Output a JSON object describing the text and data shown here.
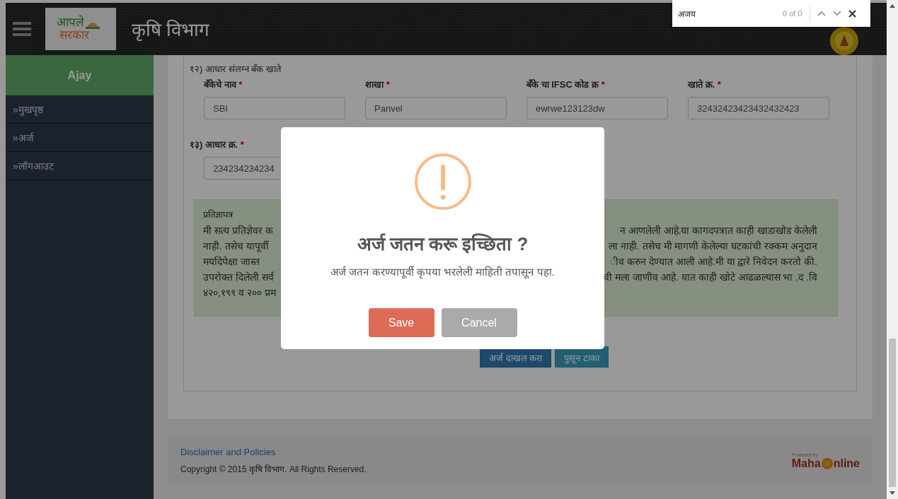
{
  "header": {
    "logo_top": "आपले",
    "logo_bottom": "सरकार",
    "title": "कृषि विभाग"
  },
  "find_bar": {
    "query": "अजय",
    "count": "0 of 0"
  },
  "sidebar": {
    "user": "Ajay",
    "items": [
      {
        "label": "»मुखपृष्ठ"
      },
      {
        "label": "»अर्ज"
      },
      {
        "label": "»लॉगआउट"
      }
    ]
  },
  "form": {
    "bank_section": "१२) आधार संलग्न बँक खाते",
    "fields": [
      {
        "label": "बँकेचे नाव",
        "required_mark": "*",
        "value": "SBI"
      },
      {
        "label": "शाखा",
        "required_mark": "*",
        "value": "Panvel"
      },
      {
        "label": "बँके चा IFSC कोड क्र",
        "required_mark": "*",
        "value": "ewrwe123123dw"
      },
      {
        "label": "खाते क्र.",
        "required_mark": "*",
        "value": "32432423423432432423"
      }
    ],
    "aadhaar": {
      "label": "१३) आधार क्र.",
      "required_mark": "*",
      "value": "234234234234"
    },
    "declaration": {
      "title": "प्रतिज्ञापत्र",
      "lines": [
        {
          "left": "मी सत्य प्रतिज्ञेवर क",
          "right": "न आणलेली आहे.या कागदपत्रात काही खाडाखोड केलेली"
        },
        {
          "left": "नाही. तसेच यापूर्वी",
          "right": "ला नाही. तसेच मी मागणी केलेल्या घटकांची रक्कम अनुदान"
        },
        {
          "left": "मर्यादेपेक्षा जास्त",
          "right": "ीव करुन देण्यात आली आहे.मी या द्वारे निवेदन करतो की."
        },
        {
          "left": "उपरोक्त दिलेली सर्व",
          "right": "वी मला जाणीव आहे. यात काही खोटे आढळल्यास भा .द .वि"
        },
        {
          "left": "४२०,१९९ व २०० प्रम"
        }
      ]
    },
    "buttons": [
      {
        "label": "अर्ज दाखल करा",
        "kind": "primary"
      },
      {
        "label": "पुसून टाका",
        "kind": "info"
      }
    ]
  },
  "footer": {
    "link": "Disclaimer and Policies",
    "copyright": "Copyright © 2015 कृषि विभाग. All Rights Reserved.",
    "powered_by": "Powered by",
    "logo_left": "Maha",
    "logo_right": "nline"
  },
  "dialog": {
    "title": "अर्ज जतन करू इच्छिता ?",
    "message": "अर्ज जतन करण्यापूर्वी कृपया भरलेली माहिती तपासून पहा.",
    "buttons": [
      {
        "label": "Save",
        "kind": "confirm"
      },
      {
        "label": "Cancel",
        "kind": "cancel"
      }
    ]
  }
}
